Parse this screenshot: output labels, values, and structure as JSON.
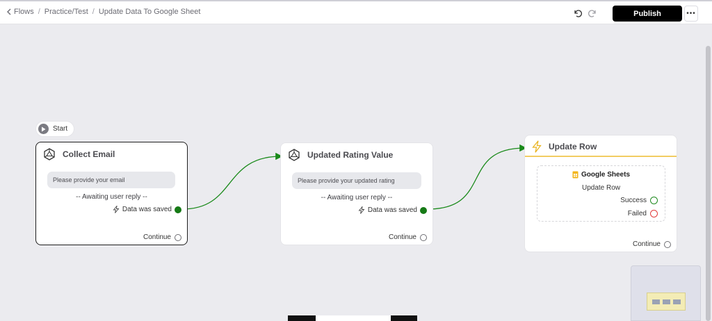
{
  "header": {
    "breadcrumb": {
      "back_label": "Flows",
      "items": [
        "Practice/Test",
        "Update Data To Google Sheet"
      ]
    },
    "publish_label": "Publish",
    "more_label": "•••"
  },
  "canvas": {
    "start_label": "Start",
    "nodes": {
      "collect_email": {
        "title": "Collect Email",
        "message": "Please provide your email",
        "awaiting": "-- Awaiting user reply --",
        "saved": "Data was saved",
        "continue": "Continue"
      },
      "updated_rating": {
        "title": "Updated Rating Value",
        "message": "Please provide your updated rating",
        "awaiting": "-- Awaiting user reply --",
        "saved": "Data was saved",
        "continue": "Continue"
      },
      "update_row": {
        "title": "Update Row",
        "integration": "Google Sheets",
        "action": "Update Row",
        "success": "Success",
        "failed": "Failed",
        "continue": "Continue"
      }
    }
  },
  "colors": {
    "edge": "#1a8a1a",
    "success_ring": "#1e8a1e",
    "failed_ring": "#e23b3b",
    "action_accent": "#f2cc62"
  },
  "icons": [
    "chevron-left-icon",
    "undo-icon",
    "redo-icon",
    "play-icon",
    "ai-agent-icon",
    "lightning-icon",
    "google-sheets-icon"
  ]
}
